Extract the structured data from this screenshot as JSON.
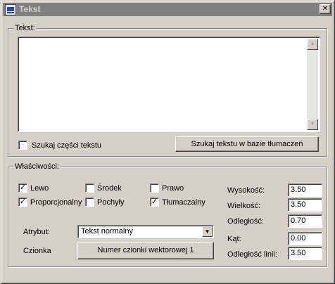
{
  "window": {
    "title": "Tekst",
    "close_glyph": "✕"
  },
  "text_group": {
    "legend": "Tekst:",
    "textarea_value": "",
    "scroll_up": "▲",
    "scroll_down": "▼",
    "search_part_label": "Szukaj części tekstu",
    "search_part_checked": false,
    "search_button": "Szukaj tekstu w bazie tłumaczeń"
  },
  "properties": {
    "legend": "Właściwości:",
    "checkboxes": [
      {
        "label": "Lewo",
        "checked": true
      },
      {
        "label": "Środek",
        "checked": false
      },
      {
        "label": "Prawo",
        "checked": false
      },
      {
        "label": "Proporcjonalny",
        "checked": true
      },
      {
        "label": "Pochyły",
        "checked": false
      },
      {
        "label": "Tłumaczalny",
        "checked": true
      }
    ],
    "check_mark": "✓",
    "attribute_label": "Atrybut:",
    "attribute_value": "Tekst normalny",
    "dropdown_arrow": "▼",
    "font_label": "Czionka",
    "font_button": "Numer czionki wektorowej 1",
    "fields": [
      {
        "label": "Wysokość:",
        "value": "3.50"
      },
      {
        "label": "Wielkość:",
        "value": "3.50"
      },
      {
        "label": "Odległość:",
        "value": "0.70"
      },
      {
        "label": "Kąt:",
        "value": "0.00"
      },
      {
        "label": "Odległość linii:",
        "value": "3.50"
      }
    ]
  }
}
